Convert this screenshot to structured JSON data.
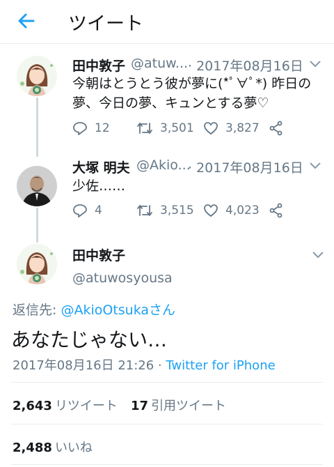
{
  "header": {
    "title": "ツイート"
  },
  "tweet1": {
    "name": "田中敦子",
    "handle": "@atuw...",
    "date": "· 2017年08月16日",
    "line1": "今朝はとうとう彼が夢に(*ﾟ∀ﾟ*) 昨日の",
    "line2": "夢、今日の夢、キュンとする夢♡",
    "replies": "12",
    "retweets": "3,501",
    "likes": "3,827"
  },
  "tweet2": {
    "name": "大塚 明夫",
    "handle": "@Akio...",
    "date": "· 2017年08月16日",
    "line1": "少佐……",
    "replies": "4",
    "retweets": "3,515",
    "likes": "4,023"
  },
  "main": {
    "name": "田中敦子",
    "handle": "@atuwosyousa",
    "reply_label": "返信先:",
    "reply_user": "@AkioOtsukaさん",
    "text": "あなたじゃない…",
    "datetime": "2017年08月16日 21:26 · ",
    "via": "Twitter for iPhone",
    "retweet_count": "2,643",
    "retweet_label": "リツイート",
    "quote_count": "17",
    "quote_label": "引用ツイート",
    "like_count": "2,488",
    "like_label": "いいね"
  },
  "colors": {
    "accent": "#1da1f2",
    "muted": "#657786",
    "text": "#14171a"
  }
}
